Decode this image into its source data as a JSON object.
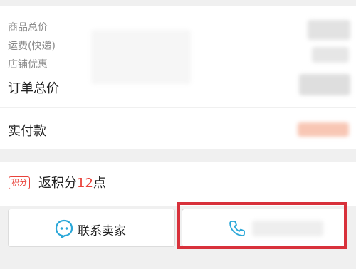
{
  "order_summary": {
    "goods_total_label": "商品总价",
    "shipping_label": "运费(快递)",
    "shop_discount_label": "店铺优惠",
    "order_total_label": "订单总价"
  },
  "payment": {
    "paid_label": "实付款"
  },
  "points": {
    "badge": "积分",
    "prefix": "返积分",
    "amount": "12",
    "suffix": "点"
  },
  "actions": {
    "contact_seller_label": "联系卖家"
  },
  "colors": {
    "accent_red": "#e9423a",
    "highlight_red": "#d8313b",
    "chat_icon_blue": "#2aa7d8"
  },
  "icons": [
    "chat-bubble-icon",
    "phone-icon"
  ]
}
